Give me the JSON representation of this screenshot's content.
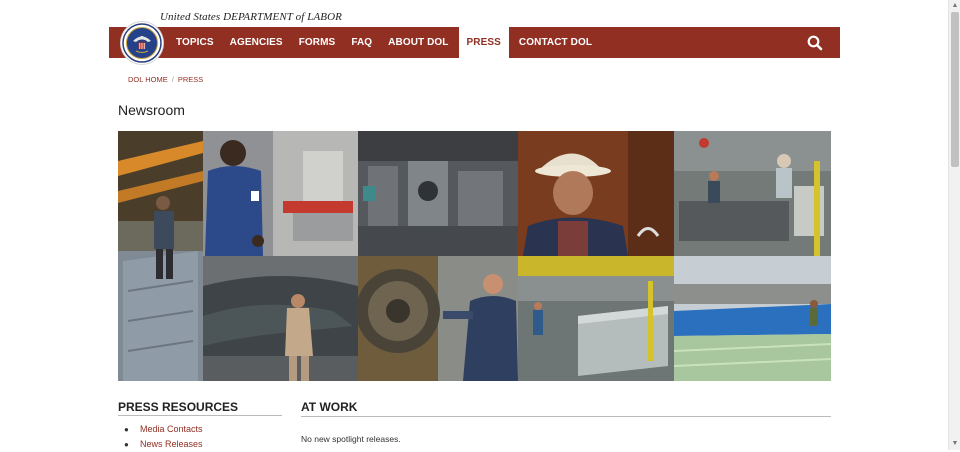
{
  "header": {
    "agency_title": "United States DEPARTMENT of LABOR"
  },
  "nav": {
    "items": [
      {
        "label": "TOPICS",
        "active": false
      },
      {
        "label": "AGENCIES",
        "active": false
      },
      {
        "label": "FORMS",
        "active": false
      },
      {
        "label": "FAQ",
        "active": false
      },
      {
        "label": "ABOUT DOL",
        "active": false
      },
      {
        "label": "PRESS",
        "active": true
      },
      {
        "label": "CONTACT DOL",
        "active": false
      }
    ],
    "search_icon": "search-icon"
  },
  "breadcrumb": {
    "home": "DOL HOME",
    "separator": "/",
    "current": "PRESS"
  },
  "page_title": "Newsroom",
  "sidebar": {
    "heading": "PRESS RESOURCES",
    "links": [
      "Media Contacts",
      "News Releases"
    ]
  },
  "main": {
    "heading": "AT WORK",
    "empty_message": "No new spotlight releases."
  },
  "colors": {
    "brand": "#922f23",
    "text": "#222222"
  }
}
